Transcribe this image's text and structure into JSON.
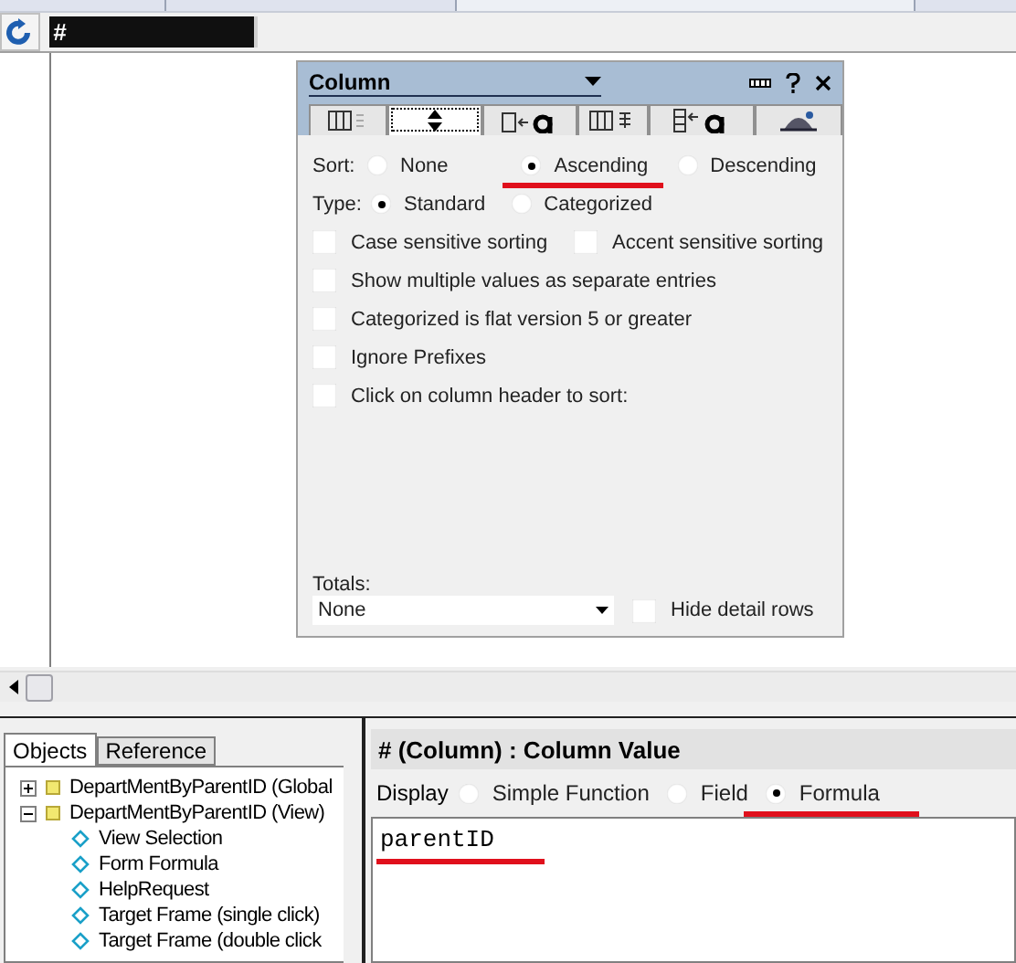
{
  "column_header": {
    "label": "#",
    "selected": true
  },
  "dialog": {
    "title": "Column",
    "tabs": [
      {
        "kind": "info",
        "selected": false
      },
      {
        "kind": "sort",
        "selected": true
      },
      {
        "kind": "font",
        "selected": false
      },
      {
        "kind": "numbers",
        "selected": false
      },
      {
        "kind": "title",
        "selected": false
      },
      {
        "kind": "advanced",
        "selected": false
      }
    ],
    "sort": {
      "label": "Sort:",
      "options": [
        {
          "label": "None",
          "selected": false,
          "underlined": false
        },
        {
          "label": "Ascending",
          "selected": true,
          "underlined": true
        },
        {
          "label": "Descending",
          "selected": false,
          "underlined": false
        }
      ]
    },
    "type": {
      "label": "Type:",
      "options": [
        {
          "label": "Standard",
          "selected": true,
          "underlined": false
        },
        {
          "label": "Categorized",
          "selected": false,
          "underlined": false
        }
      ]
    },
    "checkbox_rows": [
      [
        {
          "label": "Case sensitive sorting",
          "checked": false
        },
        {
          "label": "Accent sensitive sorting",
          "checked": false
        }
      ],
      [
        {
          "label": "Show multiple values as separate entries",
          "checked": false
        }
      ],
      [
        {
          "label": "Categorized is flat version 5 or greater",
          "checked": false
        }
      ],
      [
        {
          "label": "Ignore Prefixes",
          "checked": false
        }
      ],
      [
        {
          "label": "Click on column header to sort:",
          "checked": false
        }
      ]
    ],
    "totals": {
      "label": "Totals:",
      "value": "None"
    },
    "hide_detail_rows": {
      "label": "Hide detail rows",
      "checked": false
    }
  },
  "left_pane": {
    "tabs": [
      {
        "label": "Objects",
        "selected": true
      },
      {
        "label": "Reference",
        "selected": false
      }
    ],
    "tree": [
      {
        "label": "DepartMentByParentID (Global",
        "expanded": false
      },
      {
        "label": "DepartMentByParentID (View)",
        "expanded": true,
        "children": [
          {
            "label": "View Selection"
          },
          {
            "label": "Form Formula"
          },
          {
            "label": "HelpRequest"
          },
          {
            "label": "Target Frame (single click)"
          },
          {
            "label": "Target Frame (double click"
          }
        ]
      }
    ]
  },
  "right_pane": {
    "title": "# (Column) : Column Value",
    "display_label": "Display",
    "display_options": [
      {
        "label": "Simple Function",
        "selected": false,
        "underlined": false
      },
      {
        "label": "Field",
        "selected": false,
        "underlined": false
      },
      {
        "label": "Formula",
        "selected": true,
        "underlined": true
      }
    ],
    "formula": {
      "value": "parentID",
      "underlined": true
    }
  }
}
